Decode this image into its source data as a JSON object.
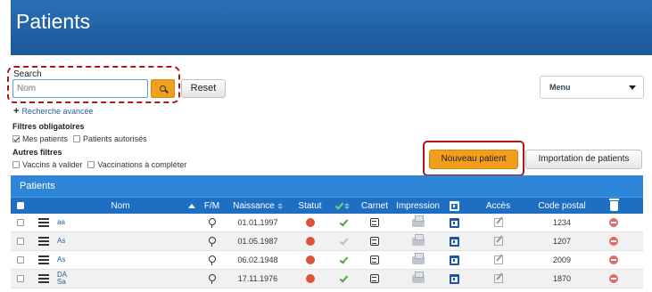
{
  "header": {
    "title": "Patients"
  },
  "search": {
    "label": "Search",
    "placeholder": "Nom",
    "reset_label": "Reset"
  },
  "menu": {
    "selected": "Menu"
  },
  "advanced_search": {
    "label": "Recherche avancée"
  },
  "filters": {
    "mandatory_title": "Filtres obligatoires",
    "mandatory": [
      {
        "label": "Mes patients",
        "checked": true
      },
      {
        "label": "Patients autorisés",
        "checked": false
      }
    ],
    "other_title": "Autres filtres",
    "other": [
      {
        "label": "Vaccins à valider",
        "checked": false
      },
      {
        "label": "Vaccinations à compléter",
        "checked": false
      }
    ]
  },
  "actions": {
    "new_patient": "Nouveau patient",
    "import_patients": "Importation de patients"
  },
  "table": {
    "caption": "Patients",
    "headers": {
      "nom": "Nom",
      "fm": "F/M",
      "naissance": "Naissance",
      "statut": "Statut",
      "carnet": "Carnet",
      "impression": "Impression",
      "acces": "Accès",
      "code_postal": "Code postal"
    },
    "rows": [
      {
        "nom": "aa",
        "naissance": "01.01.1997",
        "tick": "green",
        "code_postal": "1234"
      },
      {
        "nom": "As",
        "naissance": "01.05.1987",
        "tick": "grey",
        "code_postal": "1207"
      },
      {
        "nom": "As",
        "naissance": "06.02.1948",
        "tick": "green",
        "code_postal": "2009"
      },
      {
        "nom": "DA Sa",
        "naissance": "17.11.1976",
        "tick": "green",
        "code_postal": "1870"
      }
    ]
  },
  "colors": {
    "header_blue": "#1b5897",
    "table_blue": "#1e6fc4",
    "accent_orange": "#f29d1c",
    "highlight_red": "#b01818"
  },
  "icons": [
    "search-icon",
    "plus-icon",
    "list-icon",
    "pin-icon",
    "status-icon",
    "check-icon",
    "note-icon",
    "printer-icon",
    "calendar-icon",
    "edit-icon",
    "trash-icon",
    "delete-icon"
  ]
}
